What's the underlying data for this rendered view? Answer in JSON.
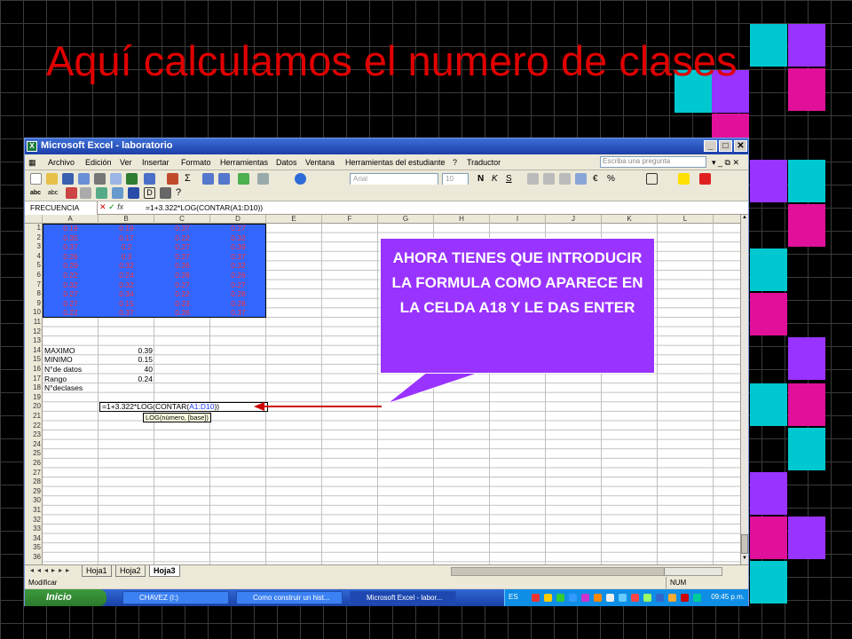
{
  "slide": {
    "title": "Aquí calculamos el numero de clases"
  },
  "colors": {
    "title": "#e00000",
    "callout": "#9933ff",
    "selection": "#3366ff",
    "data_text": "#ff3333",
    "cyan": "#00c8d0",
    "magenta": "#e0109a",
    "purple": "#9933ff"
  },
  "window": {
    "title": "Microsoft Excel - laboratorio",
    "icon": "excel-icon"
  },
  "menu": {
    "items": [
      "Archivo",
      "Edición",
      "Ver",
      "Insertar",
      "Formato",
      "Herramientas",
      "Datos",
      "Ventana",
      "Herramientas del estudiante",
      "?",
      "Traductor"
    ],
    "ask_placeholder": "Escriba una pregunta"
  },
  "toolbar": {
    "font": "Arial",
    "size": "10",
    "currency": "€",
    "percent": "%"
  },
  "formula_bar": {
    "name_box": "FRECUENCIA",
    "fx": "fx",
    "formula": "=1+3.322*LOG(CONTAR(A1:D10))"
  },
  "columns": [
    "A",
    "B",
    "C",
    "D",
    "E",
    "F",
    "G",
    "H",
    "I",
    "J",
    "K",
    "L"
  ],
  "rows": [
    "1",
    "2",
    "3",
    "4",
    "5",
    "6",
    "7",
    "8",
    "9",
    "10",
    "11",
    "12",
    "13",
    "14",
    "15",
    "16",
    "17",
    "18",
    "19",
    "20",
    "21",
    "22",
    "23",
    "24",
    "25",
    "26",
    "27",
    "28",
    "29",
    "30",
    "31",
    "32",
    "33",
    "34",
    "35",
    "36"
  ],
  "data": [
    [
      "0.19",
      "0.19",
      "0.37",
      "0.27"
    ],
    [
      "0.35",
      "0.17",
      "0.22",
      "0.32"
    ],
    [
      "0.37",
      "0.2",
      "0.27",
      "0.39"
    ],
    [
      "0.26",
      "0.3",
      "0.27",
      "0.37"
    ],
    [
      "0.29",
      "0.32",
      "0.26",
      "0.32"
    ],
    [
      "0.22",
      "0.24",
      "0.28",
      "0.26"
    ],
    [
      "0.32",
      "0.32",
      "0.27",
      "0.27"
    ],
    [
      "0.27",
      "0.34",
      "0.22",
      "0.28"
    ],
    [
      "0.27",
      "0.15",
      "0.23",
      "0.28"
    ],
    [
      "0.22",
      "0.37",
      "0.26",
      "0.37"
    ]
  ],
  "stats": [
    {
      "label": "MAXIMO",
      "value": "0.39"
    },
    {
      "label": "MINIMO",
      "value": "0.15"
    },
    {
      "label": "N°de datos",
      "value": "40"
    },
    {
      "label": "Rango",
      "value": "0.24"
    }
  ],
  "edit_cell": {
    "label": "N°declases",
    "prefix": "=1+3.322*LOG(CONTAR(",
    "ref": "A1:D10",
    "suffix": "))",
    "tooltip": "LOG(número, [base])"
  },
  "sheets": [
    "Hoja1",
    "Hoja2",
    "Hoja3"
  ],
  "status": {
    "mode": "Modificar",
    "num": "NUM"
  },
  "taskbar": {
    "start": "Inicio",
    "buttons": [
      "CHAVEZ (I:)",
      "Como construir un hist...",
      "Microsoft Excel - labor..."
    ],
    "lang": "ES",
    "clock": "09:45 p.m."
  },
  "callout": {
    "text": "AHORA TIENES QUE INTRODUCIR LA FORMULA COMO APARECE EN LA CELDA A18 Y LE DAS ENTER"
  }
}
